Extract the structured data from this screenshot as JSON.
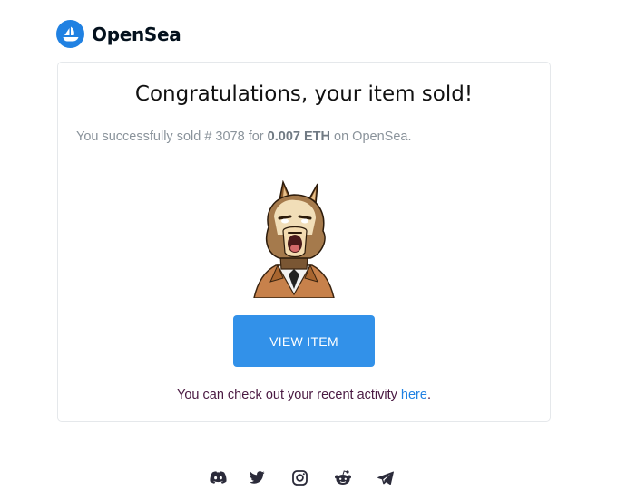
{
  "brand": {
    "name": "OpenSea",
    "color": "#2081e2"
  },
  "card": {
    "title": "Congratulations, your item sold!",
    "sold_prefix": "You successfully sold # 3078 for",
    "price": "0.007 ETH",
    "sold_suffix": "on OpenSea.",
    "button_label": "VIEW ITEM",
    "activity_text": "You can check out your recent activity",
    "activity_link": "here",
    "activity_end": "."
  },
  "socials": [
    {
      "icon": "discord-icon"
    },
    {
      "icon": "twitter-icon"
    },
    {
      "icon": "instagram-icon"
    },
    {
      "icon": "reddit-icon"
    },
    {
      "icon": "telegram-icon"
    }
  ],
  "colors": {
    "button": "#3291e9",
    "link": "#2081e2",
    "icon": "#2b2b3a"
  }
}
